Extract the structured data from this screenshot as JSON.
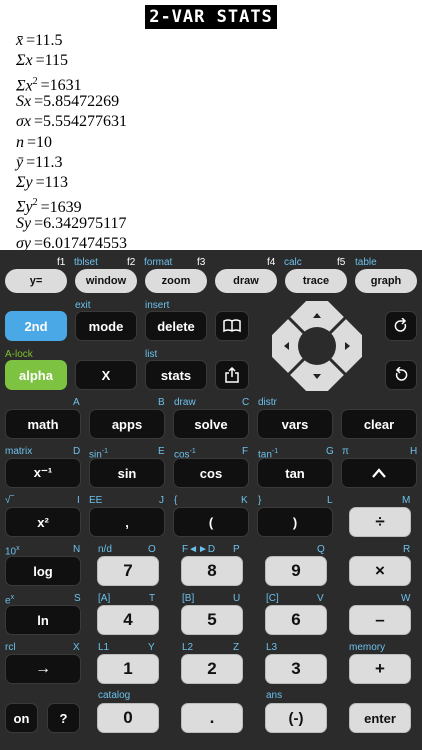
{
  "screen": {
    "title": "2-VAR STATS",
    "stats": [
      {
        "sym": "x̄",
        "val": "=11.5"
      },
      {
        "sym": "Σx",
        "val": "=115"
      },
      {
        "sym": "Σx",
        "sup": "2",
        "val": "=1631"
      },
      {
        "sym": "Sx",
        "val": "=5.85472269"
      },
      {
        "sym": "σx",
        "val": "=5.554277631"
      },
      {
        "sym": "n",
        "val": "=10"
      },
      {
        "sym": "ȳ",
        "val": "=11.3"
      },
      {
        "sym": "Σy",
        "val": "=113"
      },
      {
        "sym": "Σy",
        "sup": "2",
        "val": "=1639"
      },
      {
        "sym": "Sy",
        "val": "=6.342975117"
      },
      {
        "sym": "σy",
        "val": "=6.017474553"
      }
    ]
  },
  "keys": {
    "y_eq": "y=",
    "window": "window",
    "zoom": "zoom",
    "draw": "draw",
    "trace": "trace",
    "graph": "graph",
    "second": "2nd",
    "mode": "mode",
    "delete": "delete",
    "alpha": "alpha",
    "x": "X",
    "stats": "stats",
    "math": "math",
    "apps": "apps",
    "solve": "solve",
    "vars": "vars",
    "clear": "clear",
    "xinv": "x⁻¹",
    "sin": "sin",
    "cos": "cos",
    "tan": "tan",
    "caret": "^",
    "xsq": "x²",
    "comma": ",",
    "lparen": "(",
    "rparen": ")",
    "div": "÷",
    "log": "log",
    "seven": "7",
    "eight": "8",
    "nine": "9",
    "mul": "×",
    "ln": "ln",
    "four": "4",
    "five": "5",
    "six": "6",
    "minus": "–",
    "sto": "→",
    "one": "1",
    "two": "2",
    "three": "3",
    "plus": "+",
    "on": "on",
    "help": "?",
    "zero": "0",
    "dot": ".",
    "neg": "(-)",
    "enter": "enter"
  },
  "labels": {
    "f1": "f1",
    "tblset": "tblset",
    "f2": "f2",
    "format": "format",
    "f3": "f3",
    "f4": "f4",
    "calc": "calc",
    "f5": "f5",
    "table": "table",
    "exit": "exit",
    "insert": "insert",
    "alock": "A-lock",
    "list": "list",
    "A": "A",
    "B": "B",
    "draw": "draw",
    "C": "C",
    "distr": "distr",
    "matrix": "matrix",
    "D": "D",
    "sininv": "sin",
    "E": "E",
    "cosinv": "cos",
    "F": "F",
    "taninv": "tan",
    "G": "G",
    "pi": "π",
    "H": "H",
    "sqrt": "√‾",
    "I": "I",
    "EE": "EE",
    "J": "J",
    "lbrace": "{",
    "K": "K",
    "rbrace": "}",
    "L": "L",
    "M": "M",
    "tenx": "10",
    "N": "N",
    "nd": "n/d",
    "O": "O",
    "frac": "F◄►D",
    "P": "P",
    "Q": "Q",
    "R": "R",
    "ex": "e",
    "S": "S",
    "A1": "[A]",
    "T": "T",
    "B1": "[B]",
    "U": "U",
    "C1": "[C]",
    "V": "V",
    "W": "W",
    "rcl": "rcl",
    "X": "X",
    "L1": "L1",
    "Y": "Y",
    "L2": "L2",
    "Z": "Z",
    "L3": "L3",
    "memory": "memory",
    "catalog": "catalog",
    "ans": "ans",
    "inv": "-1",
    "x_sup": "x"
  },
  "colors": {
    "blue_key": "#4aa8e6",
    "green_key": "#7dc241",
    "label_blue": "#6cc1ec",
    "label_green": "#7fbf2d"
  }
}
